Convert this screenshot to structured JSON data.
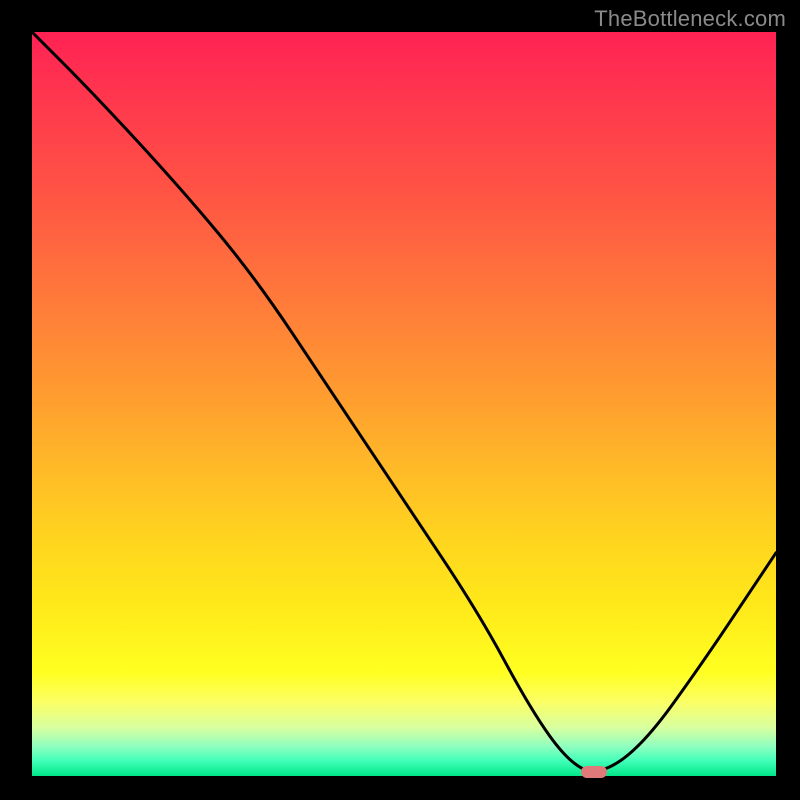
{
  "watermark": "TheBottleneck.com",
  "chart_data": {
    "type": "line",
    "title": "",
    "xlabel": "",
    "ylabel": "",
    "xlim": [
      0,
      100
    ],
    "ylim": [
      0,
      100
    ],
    "gradient_meaning": "bottleneck_severity_percent_high_red_low_green",
    "series": [
      {
        "name": "bottleneck-curve",
        "x": [
          0,
          8,
          20,
          30,
          40,
          50,
          60,
          67,
          72,
          76,
          82,
          90,
          100
        ],
        "values": [
          100,
          92,
          79,
          67,
          52,
          37,
          22,
          9,
          2,
          0,
          4,
          15,
          30
        ]
      }
    ],
    "optimal_marker": {
      "x": 75.5,
      "y": 0
    },
    "legend": []
  }
}
